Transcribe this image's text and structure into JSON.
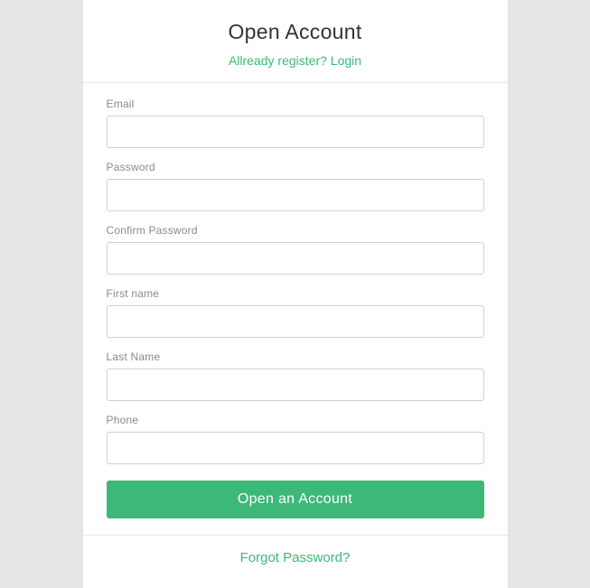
{
  "header": {
    "title": "Open Account",
    "login_link": "Allready register? Login"
  },
  "fields": {
    "email_label": "Email",
    "password_label": "Password",
    "confirm_password_label": "Confirm Password",
    "first_name_label": "First name",
    "last_name_label": "Last Name",
    "phone_label": "Phone"
  },
  "submit_label": "Open an Account",
  "footer": {
    "forgot_link": "Forgot Password?"
  }
}
